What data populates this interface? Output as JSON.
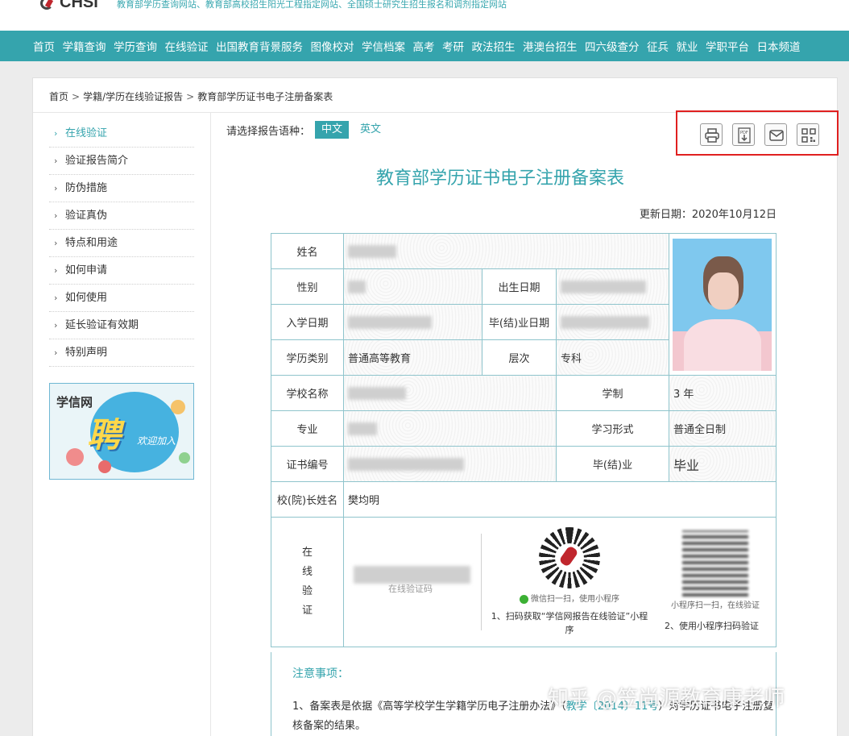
{
  "site": {
    "logo_text": "CHSI",
    "slogan": "教育部学历查询网站、教育部高校招生阳光工程指定网站、全国硕士研究生招生报名和调剂指定网站"
  },
  "nav": [
    "首页",
    "学籍查询",
    "学历查询",
    "在线验证",
    "出国教育背景服务",
    "图像校对",
    "学信档案",
    "高考",
    "考研",
    "政法招生",
    "港澳台招生",
    "四六级查分",
    "征兵",
    "就业",
    "学职平台",
    "日本频道"
  ],
  "breadcrumb": [
    "首页",
    "学籍/学历在线验证报告",
    "教育部学历证书电子注册备案表"
  ],
  "breadcrumb_sep": ">",
  "sidebar": {
    "arrow": "›",
    "items": [
      "在线验证",
      "验证报告简介",
      "防伪措施",
      "验证真伪",
      "特点和用途",
      "如何申请",
      "如何使用",
      "延长验证有效期",
      "特别声明"
    ]
  },
  "banner": {
    "brand": "学信网",
    "big": "聘",
    "small": "欢迎加入"
  },
  "language": {
    "prompt": "请选择报告语种：",
    "options": [
      "中文",
      "英文"
    ],
    "selected": "中文"
  },
  "tools": [
    "print-icon",
    "pdf-download-icon",
    "email-icon",
    "qrcode-icon"
  ],
  "document": {
    "title": "教育部学历证书电子注册备案表",
    "update_date": "更新日期：2020年10月12日",
    "labels": {
      "name": "姓名",
      "gender": "性别",
      "birth": "出生日期",
      "enroll": "入学日期",
      "graduate_date": "毕(结)业日期",
      "edu_type": "学历类别",
      "level": "层次",
      "school": "学校名称",
      "duration": "学制",
      "major": "专业",
      "study_form": "学习形式",
      "cert_no": "证书编号",
      "graduate": "毕(结)业",
      "president": "校(院)长姓名",
      "online_verify": [
        "在",
        "线",
        "验",
        "证"
      ]
    },
    "values": {
      "edu_type": "普通高等教育",
      "level": "专科",
      "duration": "3 年",
      "study_form": "普通全日制",
      "graduate": "毕业",
      "president": "樊均明"
    },
    "verify": {
      "code_caption": "在线验证码",
      "wechat_label": "微信扫一扫，使用小程序",
      "step1": "1、扫码获取“学信网报告在线验证”小程序",
      "mini_label": "小程序扫一扫，在线验证",
      "step2": "2、使用小程序扫码验证"
    },
    "notes": {
      "title": "注意事项：",
      "item1_prefix": "1、备案表是依据《高等学校学生学籍学历电子注册办法》（",
      "item1_link": "教学〔2014〕11号",
      "item1_suffix": "）对学历证书电子注册复核备案的结果。"
    }
  },
  "watermark": "知乎 @笠尚源教育康老师"
}
